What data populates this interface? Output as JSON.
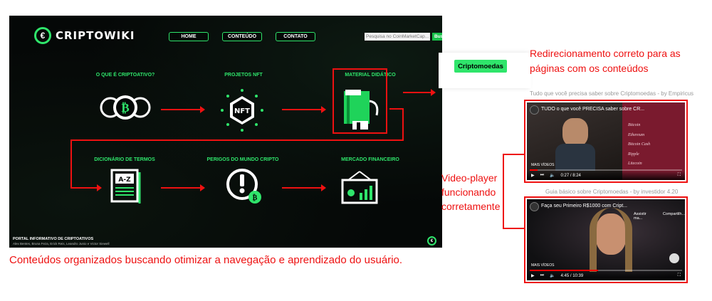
{
  "site": {
    "brand": "CRIPTOWIKI",
    "nav": [
      "HOME",
      "CONTEÚDO",
      "CONTATO"
    ],
    "search_placeholder": "Pesquisa no CoinMarketCap...",
    "search_button": "Buscar",
    "topics": [
      {
        "title": "O QUE É CRIPTOATIVO?",
        "icon": "bitcoin-coins-icon"
      },
      {
        "title": "PROJETOS NFT",
        "icon": "nft-icon"
      },
      {
        "title": "MATERIAL DIDÁTICO",
        "icon": "book-icon"
      },
      {
        "title": "DICIONÁRIO DE TERMOS",
        "icon": "dictionary-icon"
      },
      {
        "title": "PERIGOS DO MUNDO CRIPTO",
        "icon": "warning-bitcoin-icon"
      },
      {
        "title": "MERCADO FINANCEIRO",
        "icon": "chart-board-icon"
      }
    ],
    "footer_title": "PORTAL INFORMATIVO DE CRIPTOATIVOS",
    "footer_authors": "Alex Bentes, Bruna Feza, Erick Reis, Leandro Junio e Victor Siewell",
    "accent": "#2fe56b"
  },
  "annotations": {
    "main_caption": "Conteúdos organizados buscando otimizar a navegação e aprendizado do usuário.",
    "redirect_note_1": "Redirecionamento correto para as",
    "redirect_note_2": "páginas com os conteúdos",
    "player_note_1": "Video-player",
    "player_note_2": "funcionando",
    "player_note_3": "corretamente",
    "color": "#e11111"
  },
  "content_page": {
    "category": "Criptomoedas",
    "videos": [
      {
        "caption": "Tudo que você precisa saber sobre Criptomoedas - by Empiricus",
        "title": "TUDO o que você PRECISA saber sobre CR...",
        "time": "0:27 / 8:24",
        "more": "MAIS VÍDEOS",
        "progress": 0.05,
        "side_items": [
          "Bitcoin",
          "Ethereum",
          "Bitcoin Cash",
          "Ripple",
          "Litecoin"
        ]
      },
      {
        "caption": "Guia básico sobre Criptomoedas - by investidor 4.20",
        "title": "Faça seu Primeiro R$1000 com Cript...",
        "time": "4:45 / 10:39",
        "more": "MAIS VÍDEOS",
        "progress": 0.45,
        "actions": [
          "Assistir ma...",
          "Compartilh..."
        ]
      }
    ]
  }
}
